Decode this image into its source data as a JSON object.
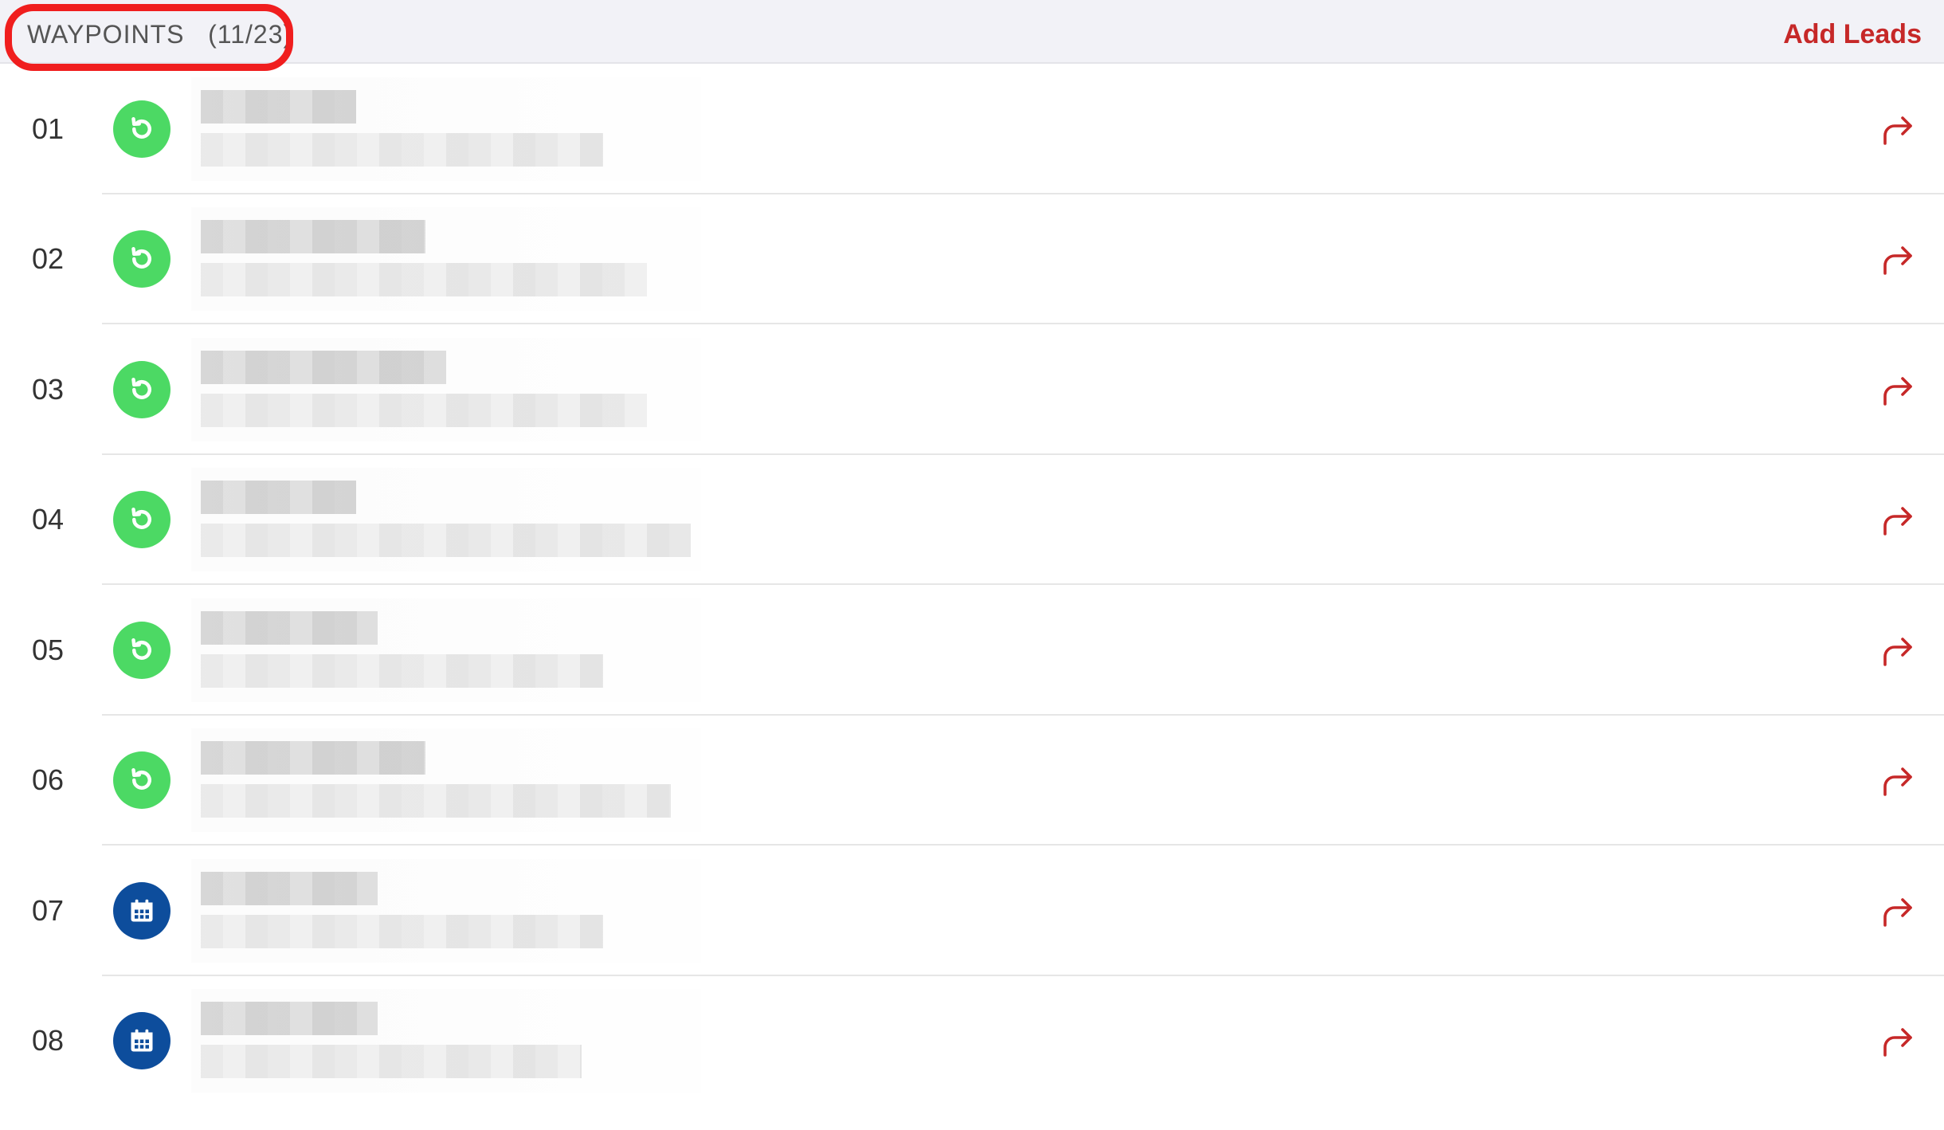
{
  "header": {
    "title": "WAYPOINTS",
    "count": "(11/23)",
    "add_leads_label": "Add Leads"
  },
  "colors": {
    "accent_red": "#c62828",
    "highlight_red": "#f01e1e",
    "status_green": "#4cd964",
    "status_blue": "#0d4d9c"
  },
  "waypoints": [
    {
      "number": "01",
      "status_icon": "refresh-icon",
      "status_color": "green"
    },
    {
      "number": "02",
      "status_icon": "refresh-icon",
      "status_color": "green"
    },
    {
      "number": "03",
      "status_icon": "refresh-icon",
      "status_color": "green"
    },
    {
      "number": "04",
      "status_icon": "refresh-icon",
      "status_color": "green"
    },
    {
      "number": "05",
      "status_icon": "refresh-icon",
      "status_color": "green"
    },
    {
      "number": "06",
      "status_icon": "refresh-icon",
      "status_color": "green"
    },
    {
      "number": "07",
      "status_icon": "calendar-icon",
      "status_color": "blue"
    },
    {
      "number": "08",
      "status_icon": "calendar-icon",
      "status_color": "blue"
    }
  ],
  "row_action_icon": "share-arrow-icon"
}
